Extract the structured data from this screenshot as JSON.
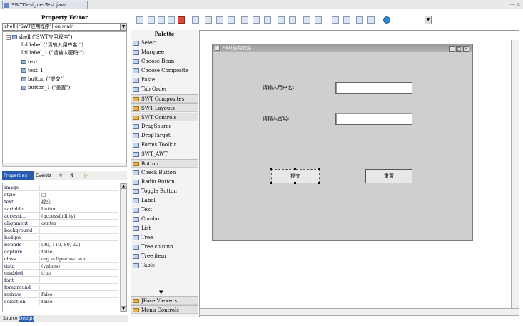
{
  "editor_tab": {
    "title": "SWTDesignerTest.java"
  },
  "property_editor": {
    "title": "Property Editor",
    "combo": "shell (\"SWT应用程序\") on main",
    "tree": [
      {
        "label": "shell (\"SWT应用程序\")"
      },
      {
        "label": "lbl label (\"请输入用户名:\")"
      },
      {
        "label": "lbl label_1 (\"请输入密码:\")"
      },
      {
        "label": "text"
      },
      {
        "label": "text_1"
      },
      {
        "label": "button (\"提交\")"
      },
      {
        "label": "button_1 (\"重置\")"
      }
    ]
  },
  "property_tabs": {
    "properties": "Properties",
    "events": "Events"
  },
  "properties": [
    {
      "key": "image",
      "value": ""
    },
    {
      "key": "style",
      "value": "□"
    },
    {
      "key": "text",
      "value": "提交"
    },
    {
      "key": "variable",
      "value": "button"
    },
    {
      "key": "accessi...",
      "value": "(accessibili ty)"
    },
    {
      "key": "alignment",
      "value": "center"
    },
    {
      "key": "background",
      "value": ""
    },
    {
      "key": "badges",
      "value": ""
    },
    {
      "key": "bounds",
      "value": "(80, 110, 80, 20)"
    },
    {
      "key": "capture",
      "value": "false"
    },
    {
      "key": "class",
      "value": "org.eclipse.swt.wid..."
    },
    {
      "key": "data",
      "value": "(values)"
    },
    {
      "key": "enabled",
      "value": "true"
    },
    {
      "key": "font",
      "value": ""
    },
    {
      "key": "foreground",
      "value": ""
    },
    {
      "key": "redraw",
      "value": "false"
    },
    {
      "key": "selection",
      "value": "false"
    }
  ],
  "bottom_tabs": {
    "source": "Source",
    "design": "Design"
  },
  "palette": {
    "title": "Palette",
    "items": [
      {
        "kind": "item",
        "label": "Select"
      },
      {
        "kind": "item",
        "label": "Marquee"
      },
      {
        "kind": "item",
        "label": "Choose Bean"
      },
      {
        "kind": "item",
        "label": "Choose Composite"
      },
      {
        "kind": "item",
        "label": "Paste"
      },
      {
        "kind": "item",
        "label": "Tab Order"
      },
      {
        "kind": "cat",
        "label": "SWT Composites"
      },
      {
        "kind": "cat",
        "label": "SWT Layouts"
      },
      {
        "kind": "cat",
        "label": "SWT Controls"
      },
      {
        "kind": "item",
        "label": "DragSource"
      },
      {
        "kind": "item",
        "label": "DropTarget"
      },
      {
        "kind": "item",
        "label": "Forms Toolkit"
      },
      {
        "kind": "item",
        "label": "SWT_AWT"
      },
      {
        "kind": "cat",
        "label": "Button"
      },
      {
        "kind": "item",
        "label": "Check Button"
      },
      {
        "kind": "item",
        "label": "Radio Button"
      },
      {
        "kind": "item",
        "label": "Toggle Button"
      },
      {
        "kind": "item",
        "label": "Label"
      },
      {
        "kind": "item",
        "label": "Text"
      },
      {
        "kind": "item",
        "label": "Combo"
      },
      {
        "kind": "item",
        "label": "List"
      },
      {
        "kind": "item",
        "label": "Tree"
      },
      {
        "kind": "item",
        "label": "Tree column"
      },
      {
        "kind": "item",
        "label": "Tree item"
      },
      {
        "kind": "item",
        "label": "Table"
      },
      {
        "kind": "cat",
        "label": "JFace Viewers"
      },
      {
        "kind": "cat",
        "label": "Menu Controls"
      }
    ]
  },
  "mock_window": {
    "title": "SWT应用程序",
    "username_label": "请输入用户名:",
    "password_label": "请输入密码:",
    "submit_button": "提交",
    "reset_button": "重置"
  }
}
